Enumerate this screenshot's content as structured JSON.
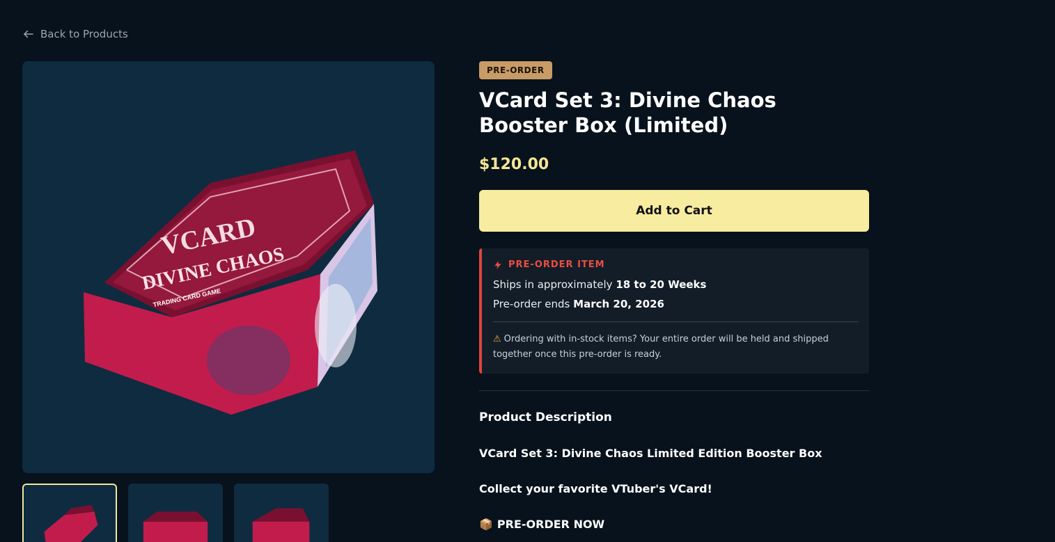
{
  "nav": {
    "back_label": "Back to Products"
  },
  "product": {
    "badge": "PRE-ORDER",
    "title": "VCard Set 3: Divine Chaos Booster Box (Limited)",
    "price": "$120.00",
    "add_to_cart_label": "Add to Cart",
    "image_text": {
      "brand": "VCARD",
      "subtitle": "DIVINE CHAOS",
      "tagline": "TRADING CARD GAME"
    }
  },
  "preorder": {
    "heading": "PRE-ORDER ITEM",
    "ships_prefix": "Ships in approximately ",
    "ships_value": "18 to 20 Weeks",
    "ends_prefix": "Pre-order ends ",
    "ends_value": "March 20, 2026",
    "note": "Ordering with in-stock items? Your entire order will be held and shipped together once this pre-order is ready."
  },
  "description": {
    "heading": "Product Description",
    "line1": "VCard Set 3: Divine Chaos Limited Edition Booster Box",
    "line2": "Collect your favorite VTuber's VCard!",
    "line3": "PRE-ORDER NOW"
  },
  "colors": {
    "accent": "#f8eca0",
    "badge": "#c99b66",
    "alert": "#e0453d",
    "background": "#07121c"
  },
  "icons": {
    "back": "arrow-left-icon",
    "lightning": "lightning-icon",
    "warning": "warning-icon",
    "package": "package-icon"
  }
}
